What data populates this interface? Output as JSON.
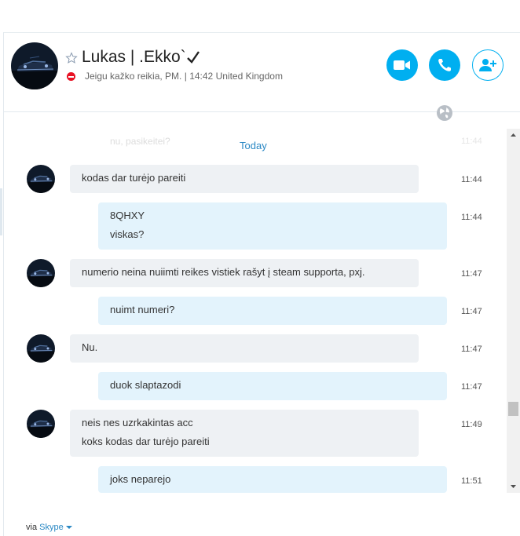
{
  "header": {
    "contact_name": "Lukas | .Ekko`",
    "mood_message": "Jeigu kažko reikia, PM.",
    "local_time": "14:42",
    "location": "United Kingdom",
    "status": "do-not-disturb"
  },
  "chat": {
    "faded_previous": {
      "text": "nu, pasikeitei?",
      "time": "11:44"
    },
    "day_separator": "Today",
    "messages": [
      {
        "direction": "incoming",
        "lines": [
          "kodas dar turėjo pareiti"
        ],
        "time": "11:44"
      },
      {
        "direction": "outgoing",
        "lines": [
          "8QHXY",
          "viskas?"
        ],
        "time": "11:44"
      },
      {
        "direction": "incoming",
        "lines": [
          "numerio neina nuiimti reikes vistiek rašyt į steam supporta, pxj."
        ],
        "time": "11:47"
      },
      {
        "direction": "outgoing",
        "lines": [
          "nuimt numeri?"
        ],
        "time": "11:47"
      },
      {
        "direction": "incoming",
        "lines": [
          "Nu."
        ],
        "time": "11:47"
      },
      {
        "direction": "outgoing",
        "lines": [
          "duok slaptazodi"
        ],
        "time": "11:47"
      },
      {
        "direction": "incoming",
        "lines": [
          "neis nes uzrkakintas acc",
          "koks kodas dar turėjo pareiti"
        ],
        "time": "11:49"
      },
      {
        "direction": "outgoing",
        "lines": [
          "joks neparejo"
        ],
        "time": "11:51"
      }
    ]
  },
  "footer": {
    "prefix": "via",
    "service": "Skype"
  },
  "colors": {
    "accent": "#00aff0",
    "link": "#2a88c4",
    "incoming_bubble": "#eef1f4",
    "outgoing_bubble": "#e3f3fc",
    "dnd": "#e81123"
  }
}
